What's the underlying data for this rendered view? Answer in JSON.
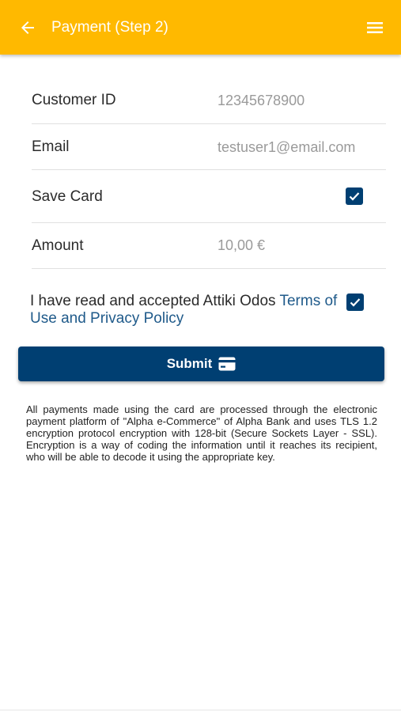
{
  "header": {
    "title": "Payment (Step 2)",
    "back_icon": "arrow-left-icon",
    "menu_icon": "hamburger-menu-icon",
    "color": "#FFB900"
  },
  "form": {
    "customer_id": {
      "label": "Customer ID",
      "value": "12345678900"
    },
    "email": {
      "label": "Email",
      "value": "testuser1@email.com"
    },
    "save_card": {
      "label": "Save Card",
      "checked": true
    },
    "amount": {
      "label": "Amount",
      "value": "10,00 €"
    }
  },
  "terms": {
    "text": "I have read and accepted Attiki Odos ",
    "link": "Terms of Use and Privacy Policy",
    "checked": true
  },
  "submit": {
    "label": "Submit",
    "icon": "credit-card-icon",
    "color": "#003F72"
  },
  "notice": "All payments made using the card are processed through the electronic payment platform of \"Alpha e-Commerce\" of Alpha Bank and uses TLS 1.2 encryption protocol encryption with 128-bit (Secure Sockets Layer - SSL). Encryption is a way of coding the information until it reaches its recipient, who will be able to decode it using the appropriate key."
}
